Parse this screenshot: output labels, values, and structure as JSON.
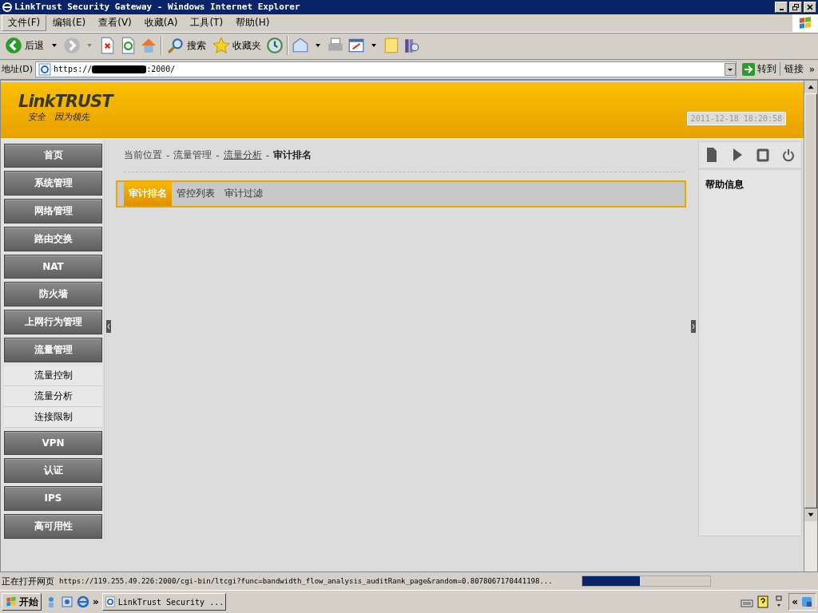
{
  "window": {
    "title": "LinkTrust Security Gateway - Windows Internet Explorer"
  },
  "menu_bar": [
    {
      "label": "文件(F)",
      "selected": true
    },
    {
      "label": "编辑(E)",
      "selected": false
    },
    {
      "label": "查看(V)",
      "selected": false
    },
    {
      "label": "收藏(A)",
      "selected": false
    },
    {
      "label": "工具(T)",
      "selected": false
    },
    {
      "label": "帮助(H)",
      "selected": false
    }
  ],
  "toolbar": {
    "back": "后退",
    "search": "搜索",
    "favorites": "收藏夹"
  },
  "address_bar": {
    "label": "地址(D)",
    "url_start": "https://",
    "url_end": ":2000/",
    "go": "转到",
    "links": "链接",
    "more": "»"
  },
  "header": {
    "logo": "LinkTRUST",
    "slogan": "安全　因为领先",
    "datetime": "2011-12-18 18:20:58"
  },
  "sidebar": {
    "items": [
      {
        "label": "首页"
      },
      {
        "label": "系统管理"
      },
      {
        "label": "网络管理"
      },
      {
        "label": "路由交换"
      },
      {
        "label": "NAT"
      },
      {
        "label": "防火墙"
      },
      {
        "label": "上网行为管理"
      },
      {
        "label": "流量管理",
        "expanded": true,
        "children": [
          {
            "label": "流量控制"
          },
          {
            "label": "流量分析"
          },
          {
            "label": "连接限制"
          }
        ]
      },
      {
        "label": "VPN"
      },
      {
        "label": "认证"
      },
      {
        "label": "IPS"
      },
      {
        "label": "高可用性"
      }
    ]
  },
  "breadcrumb": {
    "separator": "-",
    "items": [
      {
        "label": "当前位置",
        "kind": "plain"
      },
      {
        "label": "流量管理",
        "kind": "plain"
      },
      {
        "label": "流量分析",
        "kind": "link"
      },
      {
        "label": "审计排名",
        "kind": "current"
      }
    ]
  },
  "tabs": [
    {
      "label": "审计排名",
      "selected": true
    },
    {
      "label": "管控列表",
      "selected": false
    },
    {
      "label": "审计过滤",
      "selected": false
    }
  ],
  "help_panel": {
    "title": "帮助信息"
  },
  "status_bar": {
    "text": "正在打开网页",
    "url": "https://119.255.49.226:2000/cgi-bin/ltcgi?func=bandwidth_flow_analysis_auditRank_page&random=0.8078067170441198...",
    "level": 0.45
  },
  "taskbar": {
    "start": "开始",
    "more": "»",
    "task": "LinkTrust Security ...",
    "tray_more": "«"
  }
}
